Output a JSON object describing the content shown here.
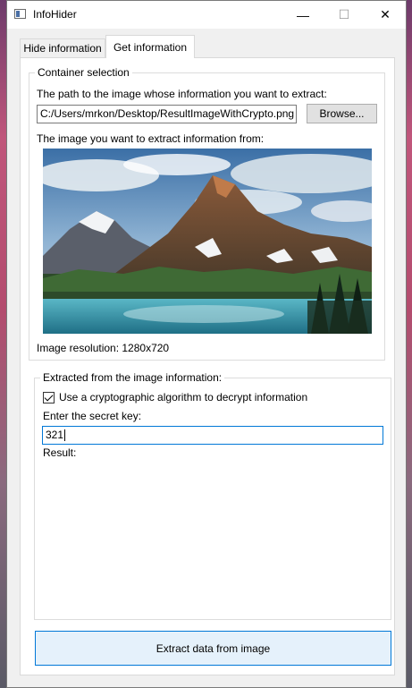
{
  "window": {
    "title": "InfoHider",
    "controls": {
      "minimize": "—",
      "maximize": "☐",
      "close": "✕"
    }
  },
  "tabs": [
    {
      "label": "Hide information",
      "active": false
    },
    {
      "label": "Get information",
      "active": true
    }
  ],
  "container": {
    "title": "Container selection",
    "path_label": "The path to the image whose information you want to extract:",
    "path_value": "C:/Users/mrkon/Desktop/ResultImageWithCrypto.png",
    "browse_label": "Browse...",
    "image_label": "The image you want to extract information from:",
    "image_resolution": "Image resolution: 1280x720"
  },
  "extracted": {
    "title": "Extracted from the image information:",
    "crypto_checkbox_label": "Use a cryptographic algorithm to decrypt information",
    "crypto_checked": true,
    "secret_key_label": "Enter the secret key:",
    "secret_key_value": "321",
    "result_label": "Result:",
    "result_value": ""
  },
  "extract_button_label": "Extract data from image",
  "colors": {
    "accent": "#0078d7",
    "button_primary_bg": "#e5f1fb"
  }
}
